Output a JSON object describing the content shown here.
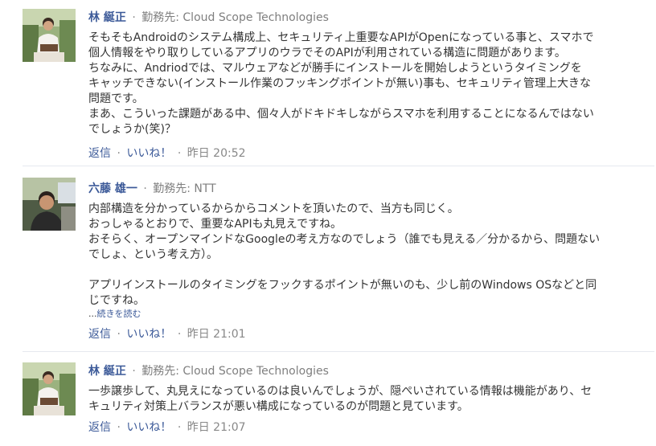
{
  "comments": [
    {
      "author": "林 綖正",
      "workplace_label": "勤務先:",
      "workplace": "Cloud Scope Technologies",
      "lines": [
        "そもそもAndroidのシステム構成上、セキュリティ上重要なAPIがOpenになっている事と、スマホで",
        "個人情報をやり取りしているアプリのウラでそのAPIが利用されている構造に問題があります。",
        "ちなみに、Andriodでは、マルウェアなどが勝手にインストールを開始しようというタイミングを",
        "キャッチできない(インストール作業のフッキングポイントが無い)事も、セキュリティ管理上大きな",
        "問題です。",
        "まあ、こういった課題がある中、個々人がドキドキしながらスマホを利用することになるんではない",
        "でしょうか(笑)？"
      ],
      "reply_label": "返信",
      "like_label": "いいね！",
      "time": "昨日 20:52"
    },
    {
      "author": "六藤 雄一",
      "workplace_label": "勤務先:",
      "workplace": "NTT",
      "lines": [
        "内部構造を分かっているからからコメントを頂いたので、当方も同じく。",
        "おっしゃるとおりで、重要なAPIも丸見えですね。",
        "おそらく、オープンマインドなGoogleの考え方なのでしょう（誰でも見える／分かるから、問題ない",
        "でしょ、という考え方）。",
        "",
        "アプリインストールのタイミングをフックするポイントが無いのも、少し前のWindows OSなどと同",
        "じですね。"
      ],
      "more_ellipsis": "...",
      "more_label": "続きを読む",
      "reply_label": "返信",
      "like_label": "いいね！",
      "time": "昨日 21:01"
    },
    {
      "author": "林 綖正",
      "workplace_label": "勤務先:",
      "workplace": "Cloud Scope Technologies",
      "lines": [
        "一歩譲歩して、丸見えになっているのは良いんでしょうが、隠ぺいされている情報は機能があり、セ",
        "キュリティ対策上バランスが悪い構成になっているのが問題と見ています。"
      ],
      "reply_label": "返信",
      "like_label": "いいね！",
      "time": "昨日 21:07"
    }
  ],
  "separator": "·",
  "colors": {
    "link": "#3b5998",
    "text": "#333333",
    "muted": "#888888",
    "divider": "#e6e9ef"
  }
}
